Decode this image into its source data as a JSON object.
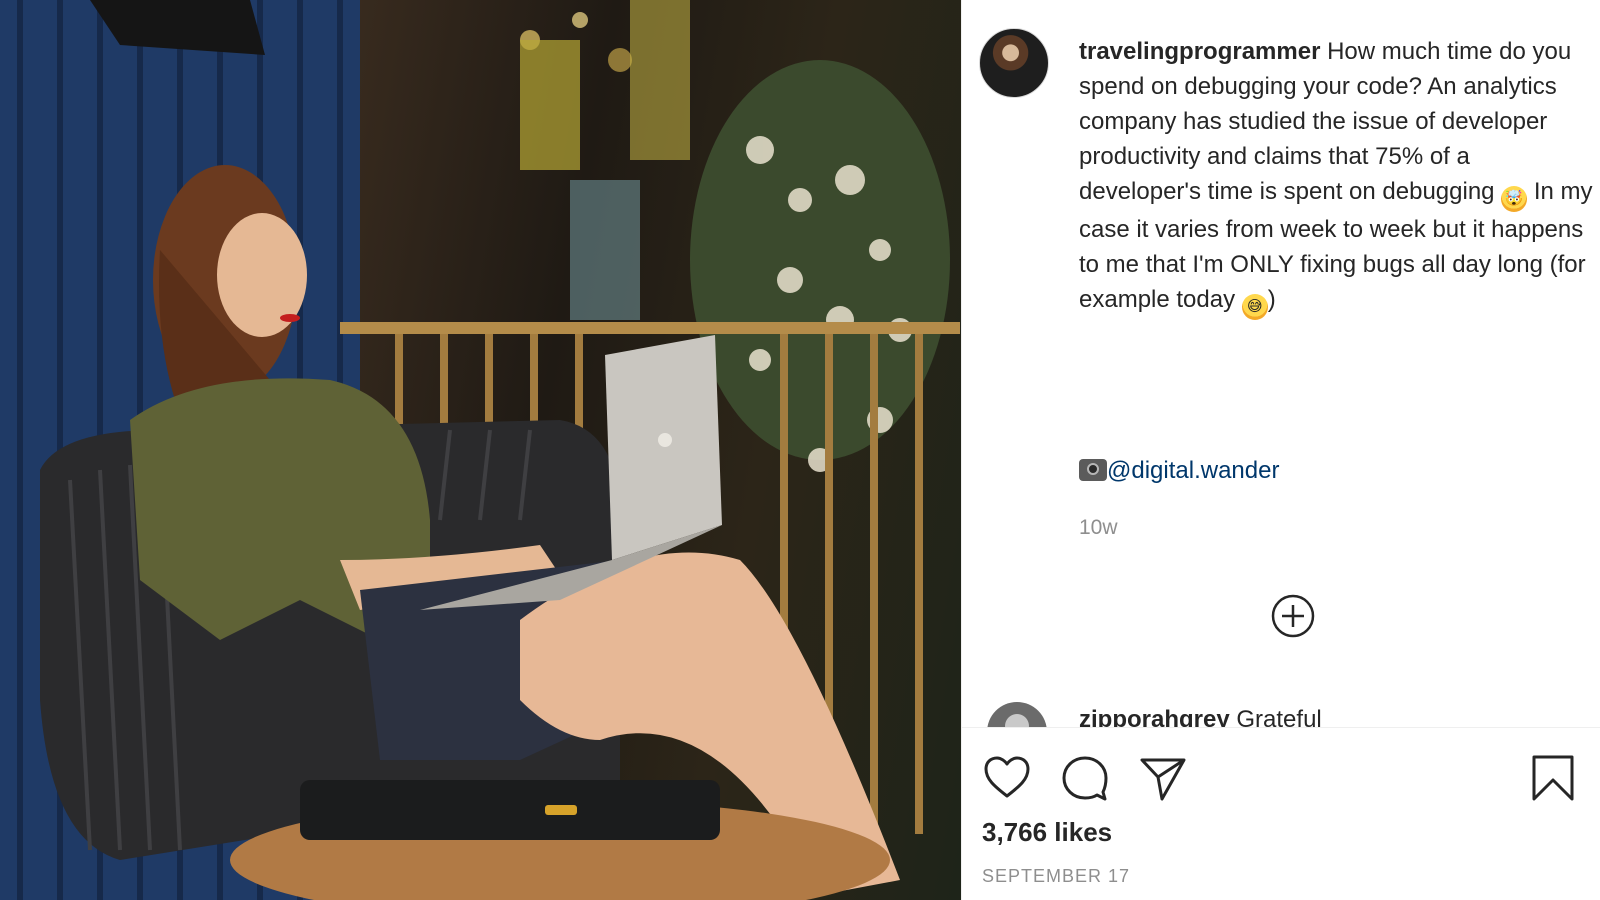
{
  "post": {
    "username": "travelingprogrammer",
    "caption_part1": " How much time do you spend on debugging your code? An analytics company has studied the issue of developer productivity and claims that 75% of a developer's time is spent on debugging ",
    "emoji_1": "🤯",
    "caption_part2": " In my case it varies from week to week but it happens to me that I'm ONLY fixing bugs all day long (for example today ",
    "emoji_2": "😅",
    "caption_part3": ")",
    "credit_icon": "camera-flash-emoji",
    "credit_mention": "@digital.wander",
    "time_ago": "10w",
    "likes": "3,766 likes",
    "date": "SEPTEMBER 17"
  },
  "comment_preview": {
    "username": "zipporahgrey",
    "text": " Grateful"
  },
  "icons": {
    "load_more": "plus-circle-icon",
    "like": "heart-icon",
    "comment": "comment-bubble-icon",
    "share": "paper-plane-icon",
    "save": "bookmark-icon"
  },
  "colors": {
    "text": "#262626",
    "secondary": "#8e8e8e",
    "mention": "#00376b",
    "divider": "#efefef"
  }
}
